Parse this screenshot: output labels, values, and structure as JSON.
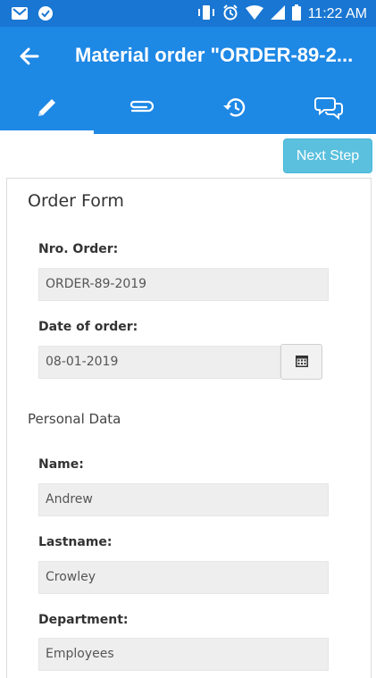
{
  "status_bar": {
    "time": "11:22 AM",
    "icons": [
      "gmail-icon",
      "notification-icon",
      "vibrate-icon",
      "alarm-icon",
      "wifi-icon",
      "signal-icon",
      "battery-icon"
    ]
  },
  "app_bar": {
    "title": "Material order \"ORDER-89-2..."
  },
  "tabs": [
    {
      "icon": "pencil-icon",
      "active": true
    },
    {
      "icon": "paperclip-icon",
      "active": false
    },
    {
      "icon": "history-icon",
      "active": false
    },
    {
      "icon": "chat-icon",
      "active": false
    }
  ],
  "toolbar": {
    "next_step_label": "Next Step"
  },
  "form": {
    "title": "Order Form",
    "order_number": {
      "label": "Nro. Order:",
      "value": "ORDER-89-2019"
    },
    "order_date": {
      "label": "Date of order:",
      "value": "08-01-2019"
    },
    "section_personal": "Personal Data",
    "name": {
      "label": "Name:",
      "value": "Andrew"
    },
    "lastname": {
      "label": "Lastname:",
      "value": "Crowley"
    },
    "department": {
      "label": "Department:",
      "value": "Employees"
    }
  },
  "colors": {
    "app_bar": "#1e88e5",
    "status_bar": "#1976d2",
    "button_info": "#5bc0de",
    "input_bg": "#eeeeee"
  }
}
